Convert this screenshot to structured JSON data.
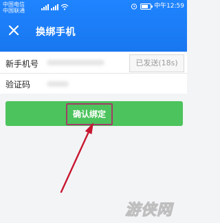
{
  "status_bar": {
    "carrier_1": "中国电信",
    "carrier_2": "中国联通",
    "time_label": "中午12:59"
  },
  "header": {
    "title": "换绑手机",
    "close_icon": "close-icon"
  },
  "form": {
    "phone_label": "新手机号",
    "code_label": "验证码",
    "resend_button_label": "已发送(18s)"
  },
  "actions": {
    "confirm_label": "确认绑定"
  },
  "colors": {
    "header_blue": "#1f84ff",
    "confirm_green": "#4cc35c",
    "highlight_border": "#a33b6a",
    "arrow_red": "#c7162e"
  },
  "watermark": {
    "text": "游侠网"
  }
}
